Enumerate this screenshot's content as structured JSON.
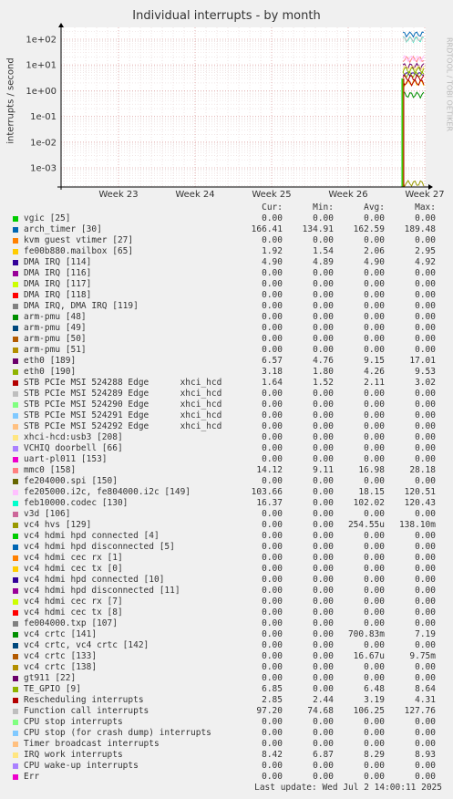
{
  "title": "Individual interrupts - by month",
  "watermark": "RRDTOOL / TOBI OETIKER",
  "columns": [
    "Cur:",
    "Min:",
    "Avg:",
    "Max:"
  ],
  "chart_data": {
    "type": "line",
    "ylabel": "interrupts / second",
    "yscale": "log",
    "ylim": [
      0.0002,
      300
    ],
    "y_ticks": [
      "1e-03",
      "1e-02",
      "1e-01",
      "1e+00",
      "1e+01",
      "1e+02"
    ],
    "x_ticks": [
      "Week 23",
      "Week 24",
      "Week 25",
      "Week 26",
      "Week 27"
    ],
    "series": [
      {
        "name": "vgic [25]",
        "color": "#00cc00",
        "values": [
          "0.00",
          "0.00",
          "0.00",
          "0.00"
        ]
      },
      {
        "name": "arch_timer [30]",
        "color": "#0066b3",
        "values": [
          "166.41",
          "134.91",
          "162.59",
          "189.48"
        ]
      },
      {
        "name": "kvm guest vtimer [27]",
        "color": "#ff8000",
        "values": [
          "0.00",
          "0.00",
          "0.00",
          "0.00"
        ]
      },
      {
        "name": "fe00b880.mailbox [65]",
        "color": "#ffcc00",
        "values": [
          "1.92",
          "1.54",
          "2.06",
          "2.95"
        ]
      },
      {
        "name": "DMA IRQ [114]",
        "color": "#330099",
        "values": [
          "4.90",
          "4.89",
          "4.90",
          "4.92"
        ]
      },
      {
        "name": "DMA IRQ [116]",
        "color": "#990099",
        "values": [
          "0.00",
          "0.00",
          "0.00",
          "0.00"
        ]
      },
      {
        "name": "DMA IRQ [117]",
        "color": "#ccff00",
        "values": [
          "0.00",
          "0.00",
          "0.00",
          "0.00"
        ]
      },
      {
        "name": "DMA IRQ [118]",
        "color": "#ff0000",
        "values": [
          "0.00",
          "0.00",
          "0.00",
          "0.00"
        ]
      },
      {
        "name": "DMA IRQ, DMA IRQ [119]",
        "color": "#808080",
        "values": [
          "0.00",
          "0.00",
          "0.00",
          "0.00"
        ]
      },
      {
        "name": "arm-pmu [48]",
        "color": "#008f00",
        "values": [
          "0.00",
          "0.00",
          "0.00",
          "0.00"
        ]
      },
      {
        "name": "arm-pmu [49]",
        "color": "#00487d",
        "values": [
          "0.00",
          "0.00",
          "0.00",
          "0.00"
        ]
      },
      {
        "name": "arm-pmu [50]",
        "color": "#b35a00",
        "values": [
          "0.00",
          "0.00",
          "0.00",
          "0.00"
        ]
      },
      {
        "name": "arm-pmu [51]",
        "color": "#b38f00",
        "values": [
          "0.00",
          "0.00",
          "0.00",
          "0.00"
        ]
      },
      {
        "name": "eth0 [189]",
        "color": "#6b006b",
        "values": [
          "6.57",
          "4.76",
          "9.15",
          "17.01"
        ]
      },
      {
        "name": "eth0 [190]",
        "color": "#8fb300",
        "values": [
          "3.18",
          "1.80",
          "4.26",
          "9.53"
        ]
      },
      {
        "name": "STB PCIe MSI 524288 Edge      xhci_hcd",
        "color": "#b30000",
        "values": [
          "1.64",
          "1.52",
          "2.11",
          "3.02"
        ]
      },
      {
        "name": "STB PCIe MSI 524289 Edge      xhci_hcd",
        "color": "#bebebe",
        "values": [
          "0.00",
          "0.00",
          "0.00",
          "0.00"
        ]
      },
      {
        "name": "STB PCIe MSI 524290 Edge      xhci_hcd",
        "color": "#80ff80",
        "values": [
          "0.00",
          "0.00",
          "0.00",
          "0.00"
        ]
      },
      {
        "name": "STB PCIe MSI 524291 Edge      xhci_hcd",
        "color": "#80c9ff",
        "values": [
          "0.00",
          "0.00",
          "0.00",
          "0.00"
        ]
      },
      {
        "name": "STB PCIe MSI 524292 Edge      xhci_hcd",
        "color": "#ffc080",
        "values": [
          "0.00",
          "0.00",
          "0.00",
          "0.00"
        ]
      },
      {
        "name": "xhci-hcd:usb3 [208]",
        "color": "#ffe680",
        "values": [
          "0.00",
          "0.00",
          "0.00",
          "0.00"
        ]
      },
      {
        "name": "VCHIQ doorbell [66]",
        "color": "#aa80ff",
        "values": [
          "0.00",
          "0.00",
          "0.00",
          "0.00"
        ]
      },
      {
        "name": "uart-pl011 [153]",
        "color": "#ee00cc",
        "values": [
          "0.00",
          "0.00",
          "0.00",
          "0.00"
        ]
      },
      {
        "name": "mmc0 [158]",
        "color": "#ff8080",
        "values": [
          "14.12",
          "9.11",
          "16.98",
          "28.18"
        ]
      },
      {
        "name": "fe204000.spi [150]",
        "color": "#666600",
        "values": [
          "0.00",
          "0.00",
          "0.00",
          "0.00"
        ]
      },
      {
        "name": "fe205000.i2c, fe804000.i2c [149]",
        "color": "#ffbfff",
        "values": [
          "103.66",
          "0.00",
          "18.15",
          "120.51"
        ]
      },
      {
        "name": "feb10000.codec [130]",
        "color": "#00ffcc",
        "values": [
          "16.37",
          "0.00",
          "102.02",
          "120.43"
        ]
      },
      {
        "name": "v3d [106]",
        "color": "#cc6699",
        "values": [
          "0.00",
          "0.00",
          "0.00",
          "0.00"
        ]
      },
      {
        "name": "vc4 hvs [129]",
        "color": "#999900",
        "values": [
          "0.00",
          "0.00",
          "254.55u",
          "138.10m"
        ]
      },
      {
        "name": "vc4 hdmi hpd connected [4]",
        "color": "#00cc00",
        "values": [
          "0.00",
          "0.00",
          "0.00",
          "0.00"
        ]
      },
      {
        "name": "vc4 hdmi hpd disconnected [5]",
        "color": "#0066b3",
        "values": [
          "0.00",
          "0.00",
          "0.00",
          "0.00"
        ]
      },
      {
        "name": "vc4 hdmi cec rx [1]",
        "color": "#ff8000",
        "values": [
          "0.00",
          "0.00",
          "0.00",
          "0.00"
        ]
      },
      {
        "name": "vc4 hdmi cec tx [0]",
        "color": "#ffcc00",
        "values": [
          "0.00",
          "0.00",
          "0.00",
          "0.00"
        ]
      },
      {
        "name": "vc4 hdmi hpd connected [10]",
        "color": "#330099",
        "values": [
          "0.00",
          "0.00",
          "0.00",
          "0.00"
        ]
      },
      {
        "name": "vc4 hdmi hpd disconnected [11]",
        "color": "#990099",
        "values": [
          "0.00",
          "0.00",
          "0.00",
          "0.00"
        ]
      },
      {
        "name": "vc4 hdmi cec rx [7]",
        "color": "#ccff00",
        "values": [
          "0.00",
          "0.00",
          "0.00",
          "0.00"
        ]
      },
      {
        "name": "vc4 hdmi cec tx [8]",
        "color": "#ff0000",
        "values": [
          "0.00",
          "0.00",
          "0.00",
          "0.00"
        ]
      },
      {
        "name": "fe004000.txp [107]",
        "color": "#808080",
        "values": [
          "0.00",
          "0.00",
          "0.00",
          "0.00"
        ]
      },
      {
        "name": "vc4 crtc [141]",
        "color": "#008f00",
        "values": [
          "0.00",
          "0.00",
          "700.83m",
          "7.19"
        ]
      },
      {
        "name": "vc4 crtc, vc4 crtc [142]",
        "color": "#00487d",
        "values": [
          "0.00",
          "0.00",
          "0.00",
          "0.00"
        ]
      },
      {
        "name": "vc4 crtc [133]",
        "color": "#b35a00",
        "values": [
          "0.00",
          "0.00",
          "16.67u",
          "9.75m"
        ]
      },
      {
        "name": "vc4 crtc [138]",
        "color": "#b38f00",
        "values": [
          "0.00",
          "0.00",
          "0.00",
          "0.00"
        ]
      },
      {
        "name": "gt911 [22]",
        "color": "#6b006b",
        "values": [
          "0.00",
          "0.00",
          "0.00",
          "0.00"
        ]
      },
      {
        "name": "TE_GPIO [9]",
        "color": "#8fb300",
        "values": [
          "6.85",
          "0.00",
          "6.48",
          "8.64"
        ]
      },
      {
        "name": "Rescheduling interrupts",
        "color": "#b30000",
        "values": [
          "2.85",
          "2.44",
          "3.19",
          "4.31"
        ]
      },
      {
        "name": "Function call interrupts",
        "color": "#bebebe",
        "values": [
          "97.20",
          "74.68",
          "106.25",
          "127.76"
        ]
      },
      {
        "name": "CPU stop interrupts",
        "color": "#80ff80",
        "values": [
          "0.00",
          "0.00",
          "0.00",
          "0.00"
        ]
      },
      {
        "name": "CPU stop (for crash dump) interrupts",
        "color": "#80c9ff",
        "values": [
          "0.00",
          "0.00",
          "0.00",
          "0.00"
        ]
      },
      {
        "name": "Timer broadcast interrupts",
        "color": "#ffc080",
        "values": [
          "0.00",
          "0.00",
          "0.00",
          "0.00"
        ]
      },
      {
        "name": "IRQ work interrupts",
        "color": "#ffe680",
        "values": [
          "8.42",
          "6.87",
          "8.29",
          "8.93"
        ]
      },
      {
        "name": "CPU wake-up interrupts",
        "color": "#aa80ff",
        "values": [
          "0.00",
          "0.00",
          "0.00",
          "0.00"
        ]
      },
      {
        "name": "Err",
        "color": "#ee00cc",
        "values": [
          "0.00",
          "0.00",
          "0.00",
          "0.00"
        ]
      }
    ]
  },
  "footer": "Last update: Wed Jul  2 14:00:11 2025"
}
